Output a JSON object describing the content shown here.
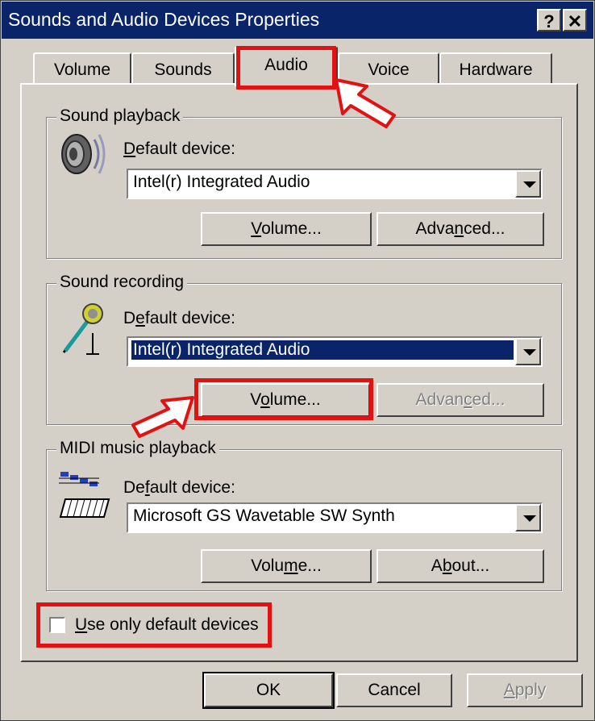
{
  "window": {
    "title": "Sounds and Audio Devices Properties",
    "help_button": "?",
    "close_button": "✕"
  },
  "tabs": [
    {
      "label": "Volume",
      "active": false
    },
    {
      "label": "Sounds",
      "active": false
    },
    {
      "label": "Audio",
      "active": true
    },
    {
      "label": "Voice",
      "active": false
    },
    {
      "label": "Hardware",
      "active": false
    }
  ],
  "sound_playback": {
    "legend": "Sound playback",
    "default_device_label_pre": "",
    "default_device_label_u": "D",
    "default_device_label_post": "efault device:",
    "device_value": "Intel(r) Integrated Audio",
    "volume_pre": "",
    "volume_u": "V",
    "volume_post": "olume...",
    "advanced_pre": "Adva",
    "advanced_u": "n",
    "advanced_post": "ced...",
    "icon": "speaker-icon"
  },
  "sound_recording": {
    "legend": "Sound recording",
    "default_device_label_pre": "D",
    "default_device_label_u": "e",
    "default_device_label_post": "fault device:",
    "device_value": "Intel(r) Integrated Audio",
    "volume_pre": "V",
    "volume_u": "o",
    "volume_post": "lume...",
    "advanced_pre": "Advan",
    "advanced_u": "c",
    "advanced_post": "ed...",
    "icon": "microphone-icon"
  },
  "midi_playback": {
    "legend": "MIDI music playback",
    "default_device_label_pre": "De",
    "default_device_label_u": "f",
    "default_device_label_post": "ault device:",
    "device_value": "Microsoft GS Wavetable SW Synth",
    "volume_pre": "Volu",
    "volume_u": "m",
    "volume_post": "e...",
    "about_pre": "A",
    "about_u": "b",
    "about_post": "out...",
    "icon": "midi-keyboard-icon"
  },
  "use_default": {
    "label_pre": "",
    "label_u": "U",
    "label_post": "se only default devices",
    "checked": false
  },
  "footer": {
    "ok": "OK",
    "cancel": "Cancel",
    "apply_u": "A",
    "apply_post": "pply"
  },
  "colors": {
    "titlebar": "#0a246a",
    "face": "#d4d0c8",
    "highlight_annotation": "#e31212"
  }
}
